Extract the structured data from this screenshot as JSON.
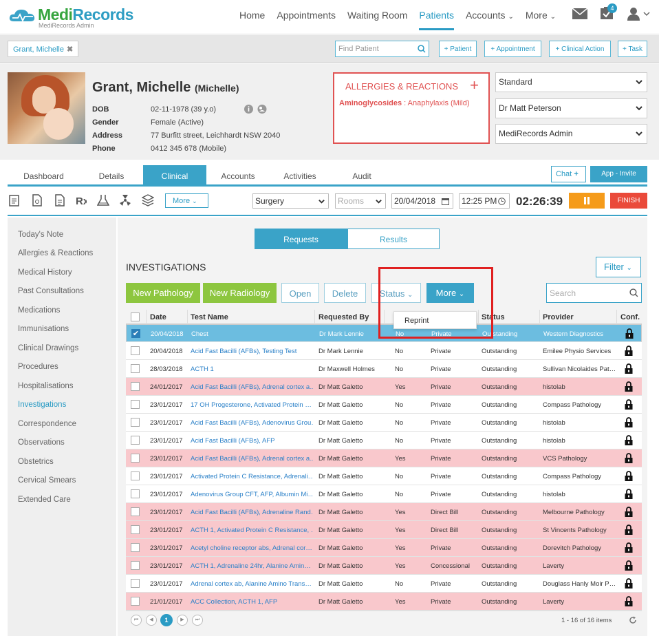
{
  "app": {
    "name_main": "Medi",
    "name_accent": "Records",
    "subtitle": "MediRecords Admin"
  },
  "nav": {
    "links": [
      "Home",
      "Appointments",
      "Waiting Room",
      "Patients",
      "Accounts",
      "More"
    ],
    "active": "Patients",
    "badge": "4"
  },
  "subbar": {
    "patient_tag": "Grant, Michelle",
    "find_placeholder": "Find Patient",
    "buttons": [
      "+ Patient",
      "+ Appointment",
      "+ Clinical Action",
      "+ Task"
    ]
  },
  "patient": {
    "name": "Grant, Michelle",
    "preferred": "(Michelle)",
    "labels": [
      "DOB",
      "Gender",
      "Address",
      "Phone"
    ],
    "values": [
      "02-11-1978 (39 y.o)",
      "Female (Active)",
      "77 Burfitt street, Leichhardt NSW 2040",
      "0412 345 678 (Mobile)"
    ]
  },
  "allergies": {
    "title": "ALLERGIES & REACTIONS",
    "add": "+",
    "item_name": "Aminoglycosides",
    "item_detail": " : Anaphylaxis (Mild)"
  },
  "selects": [
    "Standard",
    "Dr Matt Peterson",
    "MediRecords Admin"
  ],
  "tabs": [
    "Dashboard",
    "Details",
    "Clinical",
    "Accounts",
    "Activities",
    "Audit"
  ],
  "tabs_active": "Clinical",
  "chat_label": "Chat",
  "app_invite_label": "App - Invite",
  "toolbar": {
    "more_label": "More",
    "location": "Surgery",
    "rooms_placeholder": "Rooms",
    "date": "20/04/2018",
    "time": "12:25 PM",
    "timer": "02:26:39",
    "finish_label": "FINISH"
  },
  "sidebar": {
    "items": [
      "Today's Note",
      "Allergies & Reactions",
      "Medical History",
      "Past Consultations",
      "Medications",
      "Immunisations",
      "Clinical Drawings",
      "Procedures",
      "Hospitalisations",
      "Investigations",
      "Correspondence",
      "Observations",
      "Obstetrics",
      "Cervical Smears",
      "Extended Care"
    ],
    "active": "Investigations"
  },
  "segments": [
    "Requests",
    "Results"
  ],
  "investigations": {
    "title": "INVESTIGATIONS",
    "filter_label": "Filter",
    "buttons": {
      "new_pathology": "New Pathology",
      "new_radiology": "New Radiology",
      "open": "Open",
      "delete": "Delete",
      "status": "Status",
      "more": "More"
    },
    "search_placeholder": "Search",
    "dropdown_item": "Reprint",
    "columns": [
      "Date",
      "Test Name",
      "Requested By",
      "",
      "",
      "Status",
      "Provider",
      "Conf."
    ],
    "rows": [
      [
        "20/04/2018",
        "Chest",
        "Dr Mark Lennie",
        "No",
        "Private",
        "Outstanding",
        "Western Diagnostics"
      ],
      [
        "20/04/2018",
        "Acid Fast Bacilli (AFBs), Testing Test",
        "Dr Mark Lennie",
        "No",
        "Private",
        "Outstanding",
        "Emilee Physio Services"
      ],
      [
        "28/03/2018",
        "ACTH 1",
        "Dr Maxwell Holmes",
        "No",
        "Private",
        "Outstanding",
        "Sullivan Nicolaides Pat…"
      ],
      [
        "24/01/2017",
        "Acid Fast Bacilli (AFBs), Adrenal cortex a…",
        "Dr Matt Galetto",
        "Yes",
        "Private",
        "Outstanding",
        "histolab"
      ],
      [
        "23/01/2017",
        "17 OH Progesterone, Activated Protein …",
        "Dr Matt Galetto",
        "No",
        "Private",
        "Outstanding",
        "Compass Pathology"
      ],
      [
        "23/01/2017",
        "Acid Fast Bacilli (AFBs), Adenovirus Grou…",
        "Dr Matt Galetto",
        "No",
        "Private",
        "Outstanding",
        "histolab"
      ],
      [
        "23/01/2017",
        "Acid Fast Bacilli (AFBs), AFP",
        "Dr Matt Galetto",
        "No",
        "Private",
        "Outstanding",
        "histolab"
      ],
      [
        "23/01/2017",
        "Acid Fast Bacilli (AFBs), Adrenal cortex a…",
        "Dr Matt Galetto",
        "Yes",
        "Private",
        "Outstanding",
        "VCS Pathology"
      ],
      [
        "23/01/2017",
        "Activated Protein C Resistance, Adrenali…",
        "Dr Matt Galetto",
        "No",
        "Private",
        "Outstanding",
        "Compass Pathology"
      ],
      [
        "23/01/2017",
        "Adenovirus Group CFT, AFP, Albumin Mi…",
        "Dr Matt Galetto",
        "No",
        "Private",
        "Outstanding",
        "histolab"
      ],
      [
        "23/01/2017",
        "Acid Fast Bacilli (AFBs), Adrenaline Rand…",
        "Dr Matt Galetto",
        "Yes",
        "Direct Bill",
        "Outstanding",
        "Melbourne Pathology"
      ],
      [
        "23/01/2017",
        "ACTH 1, Activated Protein C Resistance, …",
        "Dr Matt Galetto",
        "Yes",
        "Direct Bill",
        "Outstanding",
        "St Vincents Pathology"
      ],
      [
        "23/01/2017",
        "Acetyl choline receptor abs, Adrenal cor…",
        "Dr Matt Galetto",
        "Yes",
        "Private",
        "Outstanding",
        "Dorevitch Pathology"
      ],
      [
        "23/01/2017",
        "ACTH 1, Adrenaline 24hr, Alanine Amin…",
        "Dr Matt Galetto",
        "Yes",
        "Concessional",
        "Outstanding",
        "Laverty"
      ],
      [
        "23/01/2017",
        "Adrenal cortex ab, Alanine Amino Trans…",
        "Dr Matt Galetto",
        "No",
        "Private",
        "Outstanding",
        "Douglass Hanly Moir P…"
      ],
      [
        "21/01/2017",
        "ACC Collection, ACTH 1, AFP",
        "Dr Matt Galetto",
        "Yes",
        "Private",
        "Outstanding",
        "Laverty"
      ]
    ],
    "row_styles": [
      "selected",
      "plain",
      "plain",
      "pink",
      "plain",
      "plain",
      "plain",
      "pink",
      "plain",
      "plain",
      "pink",
      "pink",
      "pink",
      "pink",
      "plain",
      "pink"
    ],
    "current_page": "1",
    "page_info": "1 - 16 of 16 items"
  },
  "colors": {
    "accent": "#3aa3c8",
    "green": "#8dc63f",
    "alert": "#e05252",
    "pink_row": "#f9c8cc",
    "orange": "#f59b1a"
  }
}
